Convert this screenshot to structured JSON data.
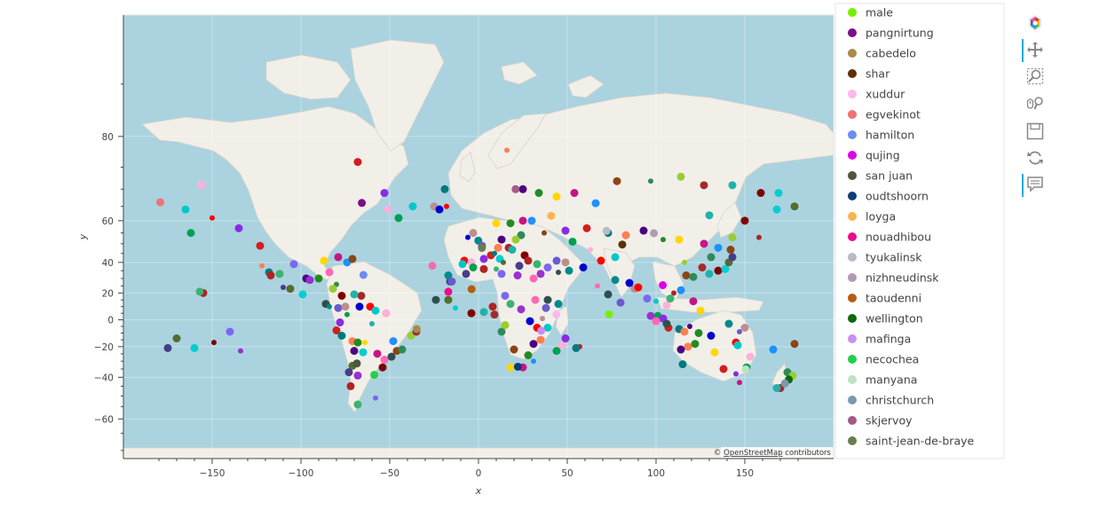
{
  "chart_data": {
    "type": "scatter",
    "title": "",
    "xlabel": "x",
    "ylabel": "y",
    "xlim": [
      -200,
      200
    ],
    "ylim": [
      -72,
      88
    ],
    "y_scale": "web-mercator",
    "x_ticks": [
      -150,
      -100,
      -50,
      0,
      50,
      100,
      150
    ],
    "y_ticks": [
      -60,
      -40,
      -20,
      0,
      20,
      40,
      60,
      80
    ],
    "tick_labels": {
      "x": [
        "−150",
        "−100",
        "−50",
        "0",
        "50",
        "100",
        "150"
      ],
      "y": [
        "−60",
        "−40",
        "−20",
        "0",
        "20",
        "40",
        "60",
        "80"
      ]
    },
    "grid": true,
    "background": "OpenStreetMap tiles",
    "legend_position": "right",
    "attribution": {
      "prefix": "© ",
      "link": "OpenStreetMap",
      "suffix": " contributors"
    },
    "series": [
      {
        "name": "male",
        "color": "#76ee00",
        "x": 73.5,
        "y": 4.2
      },
      {
        "name": "pangnirtung",
        "color": "#7a0e8a",
        "x": -65.7,
        "y": 66.1
      },
      {
        "name": "cabedelo",
        "color": "#a88a4a",
        "x": -34.8,
        "y": -7.0
      },
      {
        "name": "shar",
        "color": "#5a3205",
        "x": 81.0,
        "y": 49.6
      },
      {
        "name": "xuddur",
        "color": "#f9b9ec",
        "x": 43.9,
        "y": 4.1
      },
      {
        "name": "egvekinot",
        "color": "#f07272",
        "x": -179.2,
        "y": 66.3
      },
      {
        "name": "hamilton",
        "color": "#6c8cf0",
        "x": -64.8,
        "y": 32.3
      },
      {
        "name": "qujing",
        "color": "#dd00e8",
        "x": 103.8,
        "y": 25.5
      },
      {
        "name": "san juan",
        "color": "#4a5840",
        "x": -68.5,
        "y": -31.5
      },
      {
        "name": "oudtshoorn",
        "color": "#0e3c74",
        "x": 22.2,
        "y": -33.6
      },
      {
        "name": "loyga",
        "color": "#fbb550",
        "x": 40.9,
        "y": 61.8
      },
      {
        "name": "nouadhibou",
        "color": "#ee0a8a",
        "x": -17.0,
        "y": 20.9
      },
      {
        "name": "tyukalinsk",
        "color": "#b7bcc6",
        "x": 72.1,
        "y": 55.9
      },
      {
        "name": "nizhneudinsk",
        "color": "#b09ab6",
        "x": 98.8,
        "y": 54.9
      },
      {
        "name": "taoudenni",
        "color": "#b45f0e",
        "x": -3.9,
        "y": 22.7
      },
      {
        "name": "wellington",
        "color": "#0a6a0a",
        "x": 174.8,
        "y": -41.3
      },
      {
        "name": "mafinga",
        "color": "#c98ef2",
        "x": 35.3,
        "y": -8.3
      },
      {
        "name": "necochea",
        "color": "#23cf48",
        "x": -58.7,
        "y": -38.6
      },
      {
        "name": "manyana",
        "color": "#bfe2c0",
        "x": 150.5,
        "y": -35.3
      },
      {
        "name": "christchurch",
        "color": "#7b98ad",
        "x": 172.6,
        "y": -43.5
      },
      {
        "name": "skjervoy",
        "color": "#a45a85",
        "x": 20.9,
        "y": 70.0
      },
      {
        "name": "saint-jean-de-braye",
        "color": "#6a7d4d",
        "x": 1.9,
        "y": 47.9
      }
    ],
    "extra_point_colors": [
      "#ff0000",
      "#00c8c8",
      "#ffb0d8",
      "#00a050",
      "#8a2be2",
      "#d21e1e",
      "#007a7a",
      "#ff7f50",
      "#4b0082",
      "#228b22",
      "#ffd700",
      "#c71585",
      "#1e90ff",
      "#8b4513",
      "#2e8b57",
      "#9acd32",
      "#a52a2a",
      "#20b2aa",
      "#800000",
      "#00ced1",
      "#556b2f",
      "#483d8b",
      "#b22222",
      "#3cb371",
      "#7b68ee",
      "#9932cc",
      "#ff69b4",
      "#2f4f4f",
      "#008b8b",
      "#6a5acd",
      "#bc8f8f",
      "#0000cd"
    ],
    "extra_points": [
      [
        -150,
        61
      ],
      [
        -165,
        64
      ],
      [
        -156,
        71
      ],
      [
        -162,
        55
      ],
      [
        -135,
        57
      ],
      [
        -123,
        49
      ],
      [
        -118,
        34
      ],
      [
        -122,
        38
      ],
      [
        -97,
        30
      ],
      [
        -90,
        30
      ],
      [
        -87,
        41
      ],
      [
        -79,
        43
      ],
      [
        -74,
        40
      ],
      [
        -71,
        42
      ],
      [
        -80,
        26
      ],
      [
        -82,
        23
      ],
      [
        -66,
        18
      ],
      [
        -70,
        19
      ],
      [
        -77,
        18
      ],
      [
        -99,
        19
      ],
      [
        -106,
        23
      ],
      [
        -110,
        24
      ],
      [
        -117,
        32
      ],
      [
        -112,
        33
      ],
      [
        -104,
        39
      ],
      [
        -95,
        29
      ],
      [
        -84,
        34
      ],
      [
        -86,
        12
      ],
      [
        -84,
        10
      ],
      [
        -79,
        9
      ],
      [
        -75,
        10
      ],
      [
        -67,
        10
      ],
      [
        -61,
        10
      ],
      [
        -58,
        7
      ],
      [
        -52,
        5
      ],
      [
        -74,
        4
      ],
      [
        -78,
        -2
      ],
      [
        -80,
        -8
      ],
      [
        -77,
        -12
      ],
      [
        -71,
        -16
      ],
      [
        -70,
        -23
      ],
      [
        -68,
        -17
      ],
      [
        -64,
        -17
      ],
      [
        -57,
        -25
      ],
      [
        -48,
        -16
      ],
      [
        -46,
        -23
      ],
      [
        -43,
        -22
      ],
      [
        -38,
        -12
      ],
      [
        -35,
        -9
      ],
      [
        -60,
        -3
      ],
      [
        -54,
        -34
      ],
      [
        -65,
        -24
      ],
      [
        -71,
        -33
      ],
      [
        -73,
        -37
      ],
      [
        -72,
        -45
      ],
      [
        -68,
        -54
      ],
      [
        -58,
        -51
      ],
      [
        -68,
        -39
      ],
      [
        -53,
        -29
      ],
      [
        -49,
        -27
      ],
      [
        -0.1,
        51.5
      ],
      [
        2,
        49
      ],
      [
        -3,
        55
      ],
      [
        -6,
        53
      ],
      [
        -8,
        41
      ],
      [
        -9,
        39
      ],
      [
        -4,
        40
      ],
      [
        -3,
        37
      ],
      [
        3,
        42
      ],
      [
        7,
        44
      ],
      [
        9,
        45
      ],
      [
        11,
        48
      ],
      [
        13,
        52
      ],
      [
        18,
        59
      ],
      [
        10,
        59
      ],
      [
        25,
        60
      ],
      [
        30,
        60
      ],
      [
        37,
        55
      ],
      [
        24,
        54
      ],
      [
        21,
        52
      ],
      [
        17,
        48
      ],
      [
        19,
        47
      ],
      [
        26,
        44
      ],
      [
        12,
        42
      ],
      [
        14,
        40
      ],
      [
        23,
        38
      ],
      [
        28,
        41
      ],
      [
        33,
        39
      ],
      [
        39,
        37
      ],
      [
        35,
        33
      ],
      [
        31,
        30
      ],
      [
        45,
        34
      ],
      [
        51,
        35
      ],
      [
        44,
        41
      ],
      [
        49,
        40
      ],
      [
        59,
        37
      ],
      [
        69,
        41
      ],
      [
        77,
        43
      ],
      [
        63,
        47
      ],
      [
        53,
        51
      ],
      [
        49,
        56
      ],
      [
        61,
        57
      ],
      [
        73,
        55
      ],
      [
        83,
        54
      ],
      [
        93,
        56
      ],
      [
        104,
        52
      ],
      [
        113,
        52
      ],
      [
        127,
        50
      ],
      [
        135,
        48
      ],
      [
        142,
        47
      ],
      [
        131,
        43
      ],
      [
        143,
        53
      ],
      [
        158,
        53
      ],
      [
        130,
        62
      ],
      [
        150,
        60
      ],
      [
        168,
        64
      ],
      [
        178,
        65
      ],
      [
        -7,
        33
      ],
      [
        3,
        36
      ],
      [
        10,
        36
      ],
      [
        13,
        33
      ],
      [
        22,
        32
      ],
      [
        32,
        15
      ],
      [
        39,
        15
      ],
      [
        45,
        12
      ],
      [
        38,
        9
      ],
      [
        36,
        1
      ],
      [
        29,
        -1
      ],
      [
        33,
        -6
      ],
      [
        39,
        -6
      ],
      [
        47,
        -19
      ],
      [
        44,
        -23
      ],
      [
        49,
        -14
      ],
      [
        57,
        -20
      ],
      [
        55,
        -21
      ],
      [
        35,
        -15
      ],
      [
        31,
        -18
      ],
      [
        28,
        -26
      ],
      [
        18,
        -34
      ],
      [
        25,
        -34
      ],
      [
        31,
        -30
      ],
      [
        20,
        -22
      ],
      [
        13,
        -9
      ],
      [
        15,
        -4
      ],
      [
        9,
        4
      ],
      [
        3,
        6
      ],
      [
        -4,
        5
      ],
      [
        -13,
        9
      ],
      [
        -17,
        15
      ],
      [
        -16,
        28
      ],
      [
        8,
        10
      ],
      [
        18,
        12
      ],
      [
        15,
        18
      ],
      [
        24,
        8
      ],
      [
        67,
        25
      ],
      [
        73,
        19
      ],
      [
        77,
        29
      ],
      [
        80,
        13
      ],
      [
        88,
        23
      ],
      [
        85,
        27
      ],
      [
        90,
        24
      ],
      [
        100,
        14
      ],
      [
        106,
        11
      ],
      [
        101,
        3
      ],
      [
        104,
        1
      ],
      [
        107,
        -6
      ],
      [
        113,
        -7
      ],
      [
        116,
        -9
      ],
      [
        119,
        -5
      ],
      [
        124,
        -10
      ],
      [
        125,
        7
      ],
      [
        121,
        14
      ],
      [
        114,
        22
      ],
      [
        117,
        32
      ],
      [
        121,
        31
      ],
      [
        116,
        40
      ],
      [
        126,
        37
      ],
      [
        130,
        33
      ],
      [
        135,
        35
      ],
      [
        139,
        36
      ],
      [
        141,
        40
      ],
      [
        143,
        43
      ],
      [
        110,
        20
      ],
      [
        108,
        16
      ],
      [
        95,
        16
      ],
      [
        97,
        3
      ],
      [
        100,
        -1
      ],
      [
        106,
        -3
      ],
      [
        141,
        -3
      ],
      [
        147,
        -9
      ],
      [
        150,
        -6
      ],
      [
        131,
        -12
      ],
      [
        145,
        -17
      ],
      [
        146,
        -19
      ],
      [
        153,
        -27
      ],
      [
        151,
        -34
      ],
      [
        145,
        -38
      ],
      [
        138,
        -35
      ],
      [
        115,
        -32
      ],
      [
        118,
        -20
      ],
      [
        114,
        -22
      ],
      [
        122,
        -18
      ],
      [
        133,
        -24
      ],
      [
        147,
        -43
      ],
      [
        166,
        -22
      ],
      [
        178,
        -18
      ],
      [
        174,
        -37
      ],
      [
        177,
        -39
      ],
      [
        170,
        -46
      ],
      [
        168,
        -46
      ],
      [
        -149,
        -17
      ],
      [
        -160,
        -21
      ],
      [
        -170,
        -14
      ],
      [
        -175,
        -21
      ],
      [
        -155,
        20
      ],
      [
        -157,
        21
      ],
      [
        -140,
        -9
      ],
      [
        -134,
        -23
      ],
      [
        -26,
        38
      ],
      [
        -24,
        15
      ],
      [
        -17,
        32
      ],
      [
        -15,
        28
      ],
      [
        -25,
        65
      ],
      [
        -22,
        64
      ],
      [
        -18,
        65
      ],
      [
        -37,
        65
      ],
      [
        -51,
        64
      ],
      [
        -45,
        61
      ],
      [
        -53,
        69
      ],
      [
        -68,
        76
      ],
      [
        -19,
        70
      ],
      [
        16,
        78
      ],
      [
        25,
        70
      ],
      [
        34,
        69
      ],
      [
        44,
        68
      ],
      [
        54,
        69
      ],
      [
        66,
        66
      ],
      [
        78,
        72
      ],
      [
        97,
        72
      ],
      [
        114,
        73
      ],
      [
        127,
        71
      ],
      [
        143,
        71
      ],
      [
        159,
        69
      ],
      [
        169,
        69
      ]
    ]
  }
}
